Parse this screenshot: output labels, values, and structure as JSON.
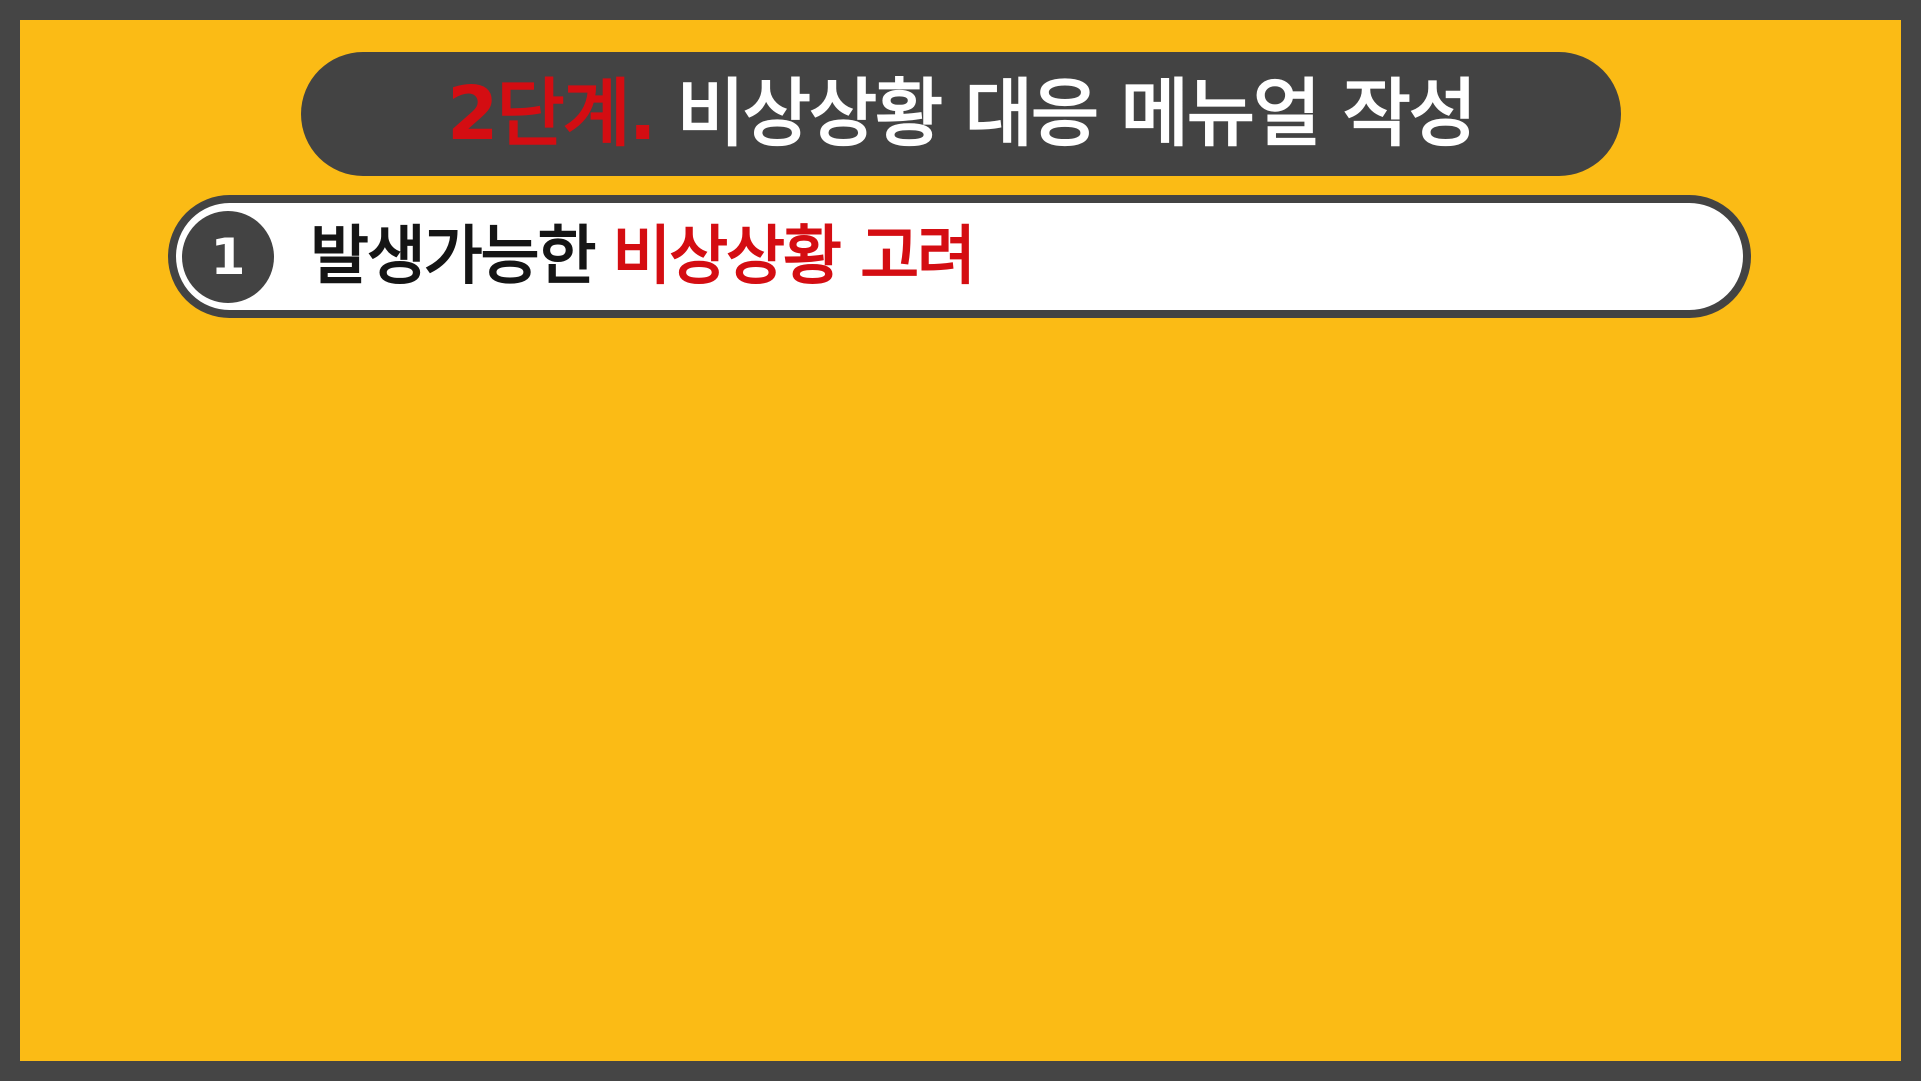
{
  "title": {
    "step_label": "2단계.",
    "main_label": "비상상황 대응 메뉴얼 작성"
  },
  "item": {
    "number": "1",
    "text": "발생가능한",
    "highlight": "비상상황 고려"
  },
  "colors": {
    "background": "#fbbb15",
    "frame": "#454545",
    "pill": "#434343",
    "accent_red": "#d40d12",
    "white": "#ffffff"
  }
}
